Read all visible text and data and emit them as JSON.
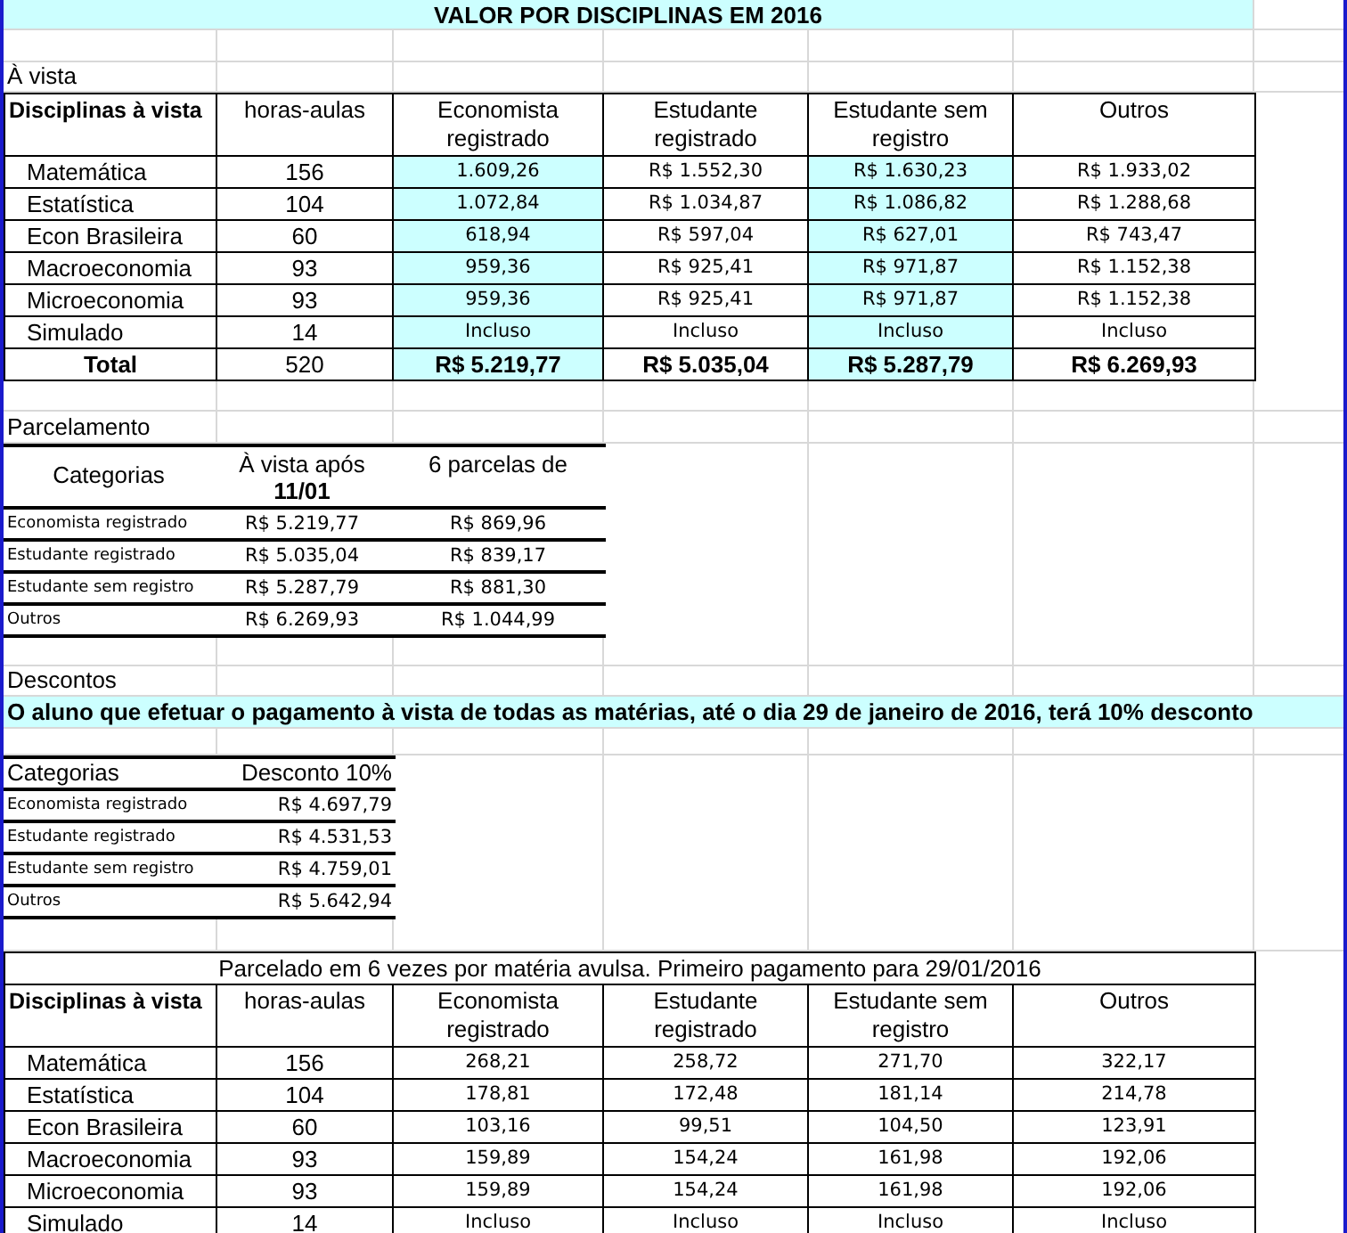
{
  "title": "VALOR POR DISCIPLINAS EM 2016",
  "a_vista": {
    "heading": "À vista",
    "columns": [
      "Disciplinas à vista",
      "horas-aulas",
      "Economista registrado",
      "Estudante registrado",
      "Estudante sem registro",
      "Outros"
    ],
    "rows": [
      {
        "name": "Matemática",
        "hours": "156",
        "values": [
          {
            "text": "1.609,26",
            "highlighted": true
          },
          {
            "text": "R$ 1.552,30",
            "highlighted": false
          },
          {
            "text": "R$ 1.630,23",
            "highlighted": true
          },
          {
            "text": "R$ 1.933,02",
            "highlighted": false
          }
        ]
      },
      {
        "name": "Estatística",
        "hours": "104",
        "values": [
          {
            "text": "1.072,84",
            "highlighted": true
          },
          {
            "text": "R$ 1.034,87",
            "highlighted": false
          },
          {
            "text": "R$ 1.086,82",
            "highlighted": true
          },
          {
            "text": "R$ 1.288,68",
            "highlighted": false
          }
        ]
      },
      {
        "name": "Econ Brasileira",
        "hours": "60",
        "values": [
          {
            "text": "618,94",
            "highlighted": true
          },
          {
            "text": "R$ 597,04",
            "highlighted": false
          },
          {
            "text": "R$ 627,01",
            "highlighted": true
          },
          {
            "text": "R$ 743,47",
            "highlighted": false
          }
        ]
      },
      {
        "name": "Macroeconomia",
        "hours": "93",
        "values": [
          {
            "text": "959,36",
            "highlighted": true
          },
          {
            "text": "R$ 925,41",
            "highlighted": false
          },
          {
            "text": "R$ 971,87",
            "highlighted": true
          },
          {
            "text": "R$ 1.152,38",
            "highlighted": false
          }
        ]
      },
      {
        "name": "Microeconomia",
        "hours": "93",
        "values": [
          {
            "text": "959,36",
            "highlighted": true
          },
          {
            "text": "R$ 925,41",
            "highlighted": false
          },
          {
            "text": "R$ 971,87",
            "highlighted": true
          },
          {
            "text": "R$ 1.152,38",
            "highlighted": false
          }
        ]
      },
      {
        "name": "Simulado",
        "hours": "14",
        "values": [
          {
            "text": "Incluso",
            "highlighted": true
          },
          {
            "text": "Incluso",
            "highlighted": false
          },
          {
            "text": "Incluso",
            "highlighted": true
          },
          {
            "text": "Incluso",
            "highlighted": false
          }
        ]
      }
    ],
    "total": {
      "label": "Total",
      "hours": "520",
      "values": [
        {
          "text": "R$ 5.219,77",
          "highlighted": true
        },
        {
          "text": "R$ 5.035,04",
          "highlighted": false
        },
        {
          "text": "R$ 5.287,79",
          "highlighted": true
        },
        {
          "text": "R$ 6.269,93",
          "highlighted": false
        }
      ]
    }
  },
  "parcelamento": {
    "heading": "Parcelamento",
    "columns": [
      "Categorias",
      "À vista após **11/01**",
      "6 parcelas de"
    ],
    "rows": [
      {
        "category": "Economista registrado",
        "cash": "R$ 5.219,77",
        "installment": "R$ 869,96"
      },
      {
        "category": "Estudante registrado",
        "cash": "R$ 5.035,04",
        "installment": "R$ 839,17"
      },
      {
        "category": "Estudante sem registro",
        "cash": "R$ 5.287,79",
        "installment": "R$ 881,30"
      },
      {
        "category": "Outros",
        "cash": "R$ 6.269,93",
        "installment": "R$ 1.044,99"
      }
    ]
  },
  "descontos": {
    "heading": "Descontos",
    "notice": "O aluno que efetuar o pagamento à vista de todas as matérias, até o dia 29 de janeiro de 2016, terá 10% desconto",
    "columns": [
      "Categorias",
      "Desconto 10%"
    ],
    "rows": [
      {
        "category": "Economista registrado",
        "value": "R$ 4.697,79"
      },
      {
        "category": "Estudante registrado",
        "value": "R$ 4.531,53"
      },
      {
        "category": "Estudante sem registro",
        "value": "R$ 4.759,01"
      },
      {
        "category": "Outros",
        "value": "R$ 5.642,94"
      }
    ]
  },
  "parcelado": {
    "title": "Parcelado em 6 vezes por matéria avulsa. Primeiro pagamento para 29/01/2016",
    "columns": [
      "Disciplinas à vista",
      "horas-aulas",
      "Economista registrado",
      "Estudante registrado",
      "Estudante sem registro",
      "Outros"
    ],
    "rows": [
      {
        "name": "Matemática",
        "hours": "156",
        "values": [
          "268,21",
          "258,72",
          "271,70",
          "322,17"
        ]
      },
      {
        "name": "Estatística",
        "hours": "104",
        "values": [
          "178,81",
          "172,48",
          "181,14",
          "214,78"
        ]
      },
      {
        "name": "Econ Brasileira",
        "hours": "60",
        "values": [
          "103,16",
          "99,51",
          "104,50",
          "123,91"
        ]
      },
      {
        "name": "Macroeconomia",
        "hours": "93",
        "values": [
          "159,89",
          "154,24",
          "161,98",
          "192,06"
        ]
      },
      {
        "name": "Microeconomia",
        "hours": "93",
        "values": [
          "159,89",
          "154,24",
          "161,98",
          "192,06"
        ]
      },
      {
        "name": "Simulado",
        "hours": "14",
        "values": [
          "Incluso",
          "Incluso",
          "Incluso",
          "Incluso"
        ]
      }
    ]
  }
}
